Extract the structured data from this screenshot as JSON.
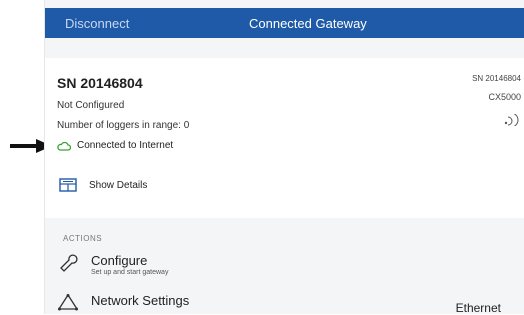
{
  "header": {
    "disconnect_label": "Disconnect",
    "title": "Connected Gateway"
  },
  "device": {
    "serial": "SN 20146804",
    "config_status": "Not Configured",
    "loggers_label": "Number of loggers in range:",
    "loggers_count": "0",
    "connection_status": "Connected to Internet",
    "right_serial": "SN 20146804",
    "model": "CX5000",
    "signal_icon": "wireless-signal-icon",
    "cloud_icon": "cloud-icon"
  },
  "details": {
    "label": "Show Details",
    "icon": "details-icon"
  },
  "actions": {
    "section_label": "ACTIONS",
    "configure": {
      "title": "Configure",
      "subtitle": "Set up and start gateway",
      "icon": "wrench-icon"
    },
    "network": {
      "title": "Network Settings",
      "value": "Ethernet",
      "icon": "network-icon"
    }
  },
  "colors": {
    "navbar": "#1e5aa8",
    "connected_green": "#3aa335",
    "accent_blue": "#1e5aa8"
  }
}
